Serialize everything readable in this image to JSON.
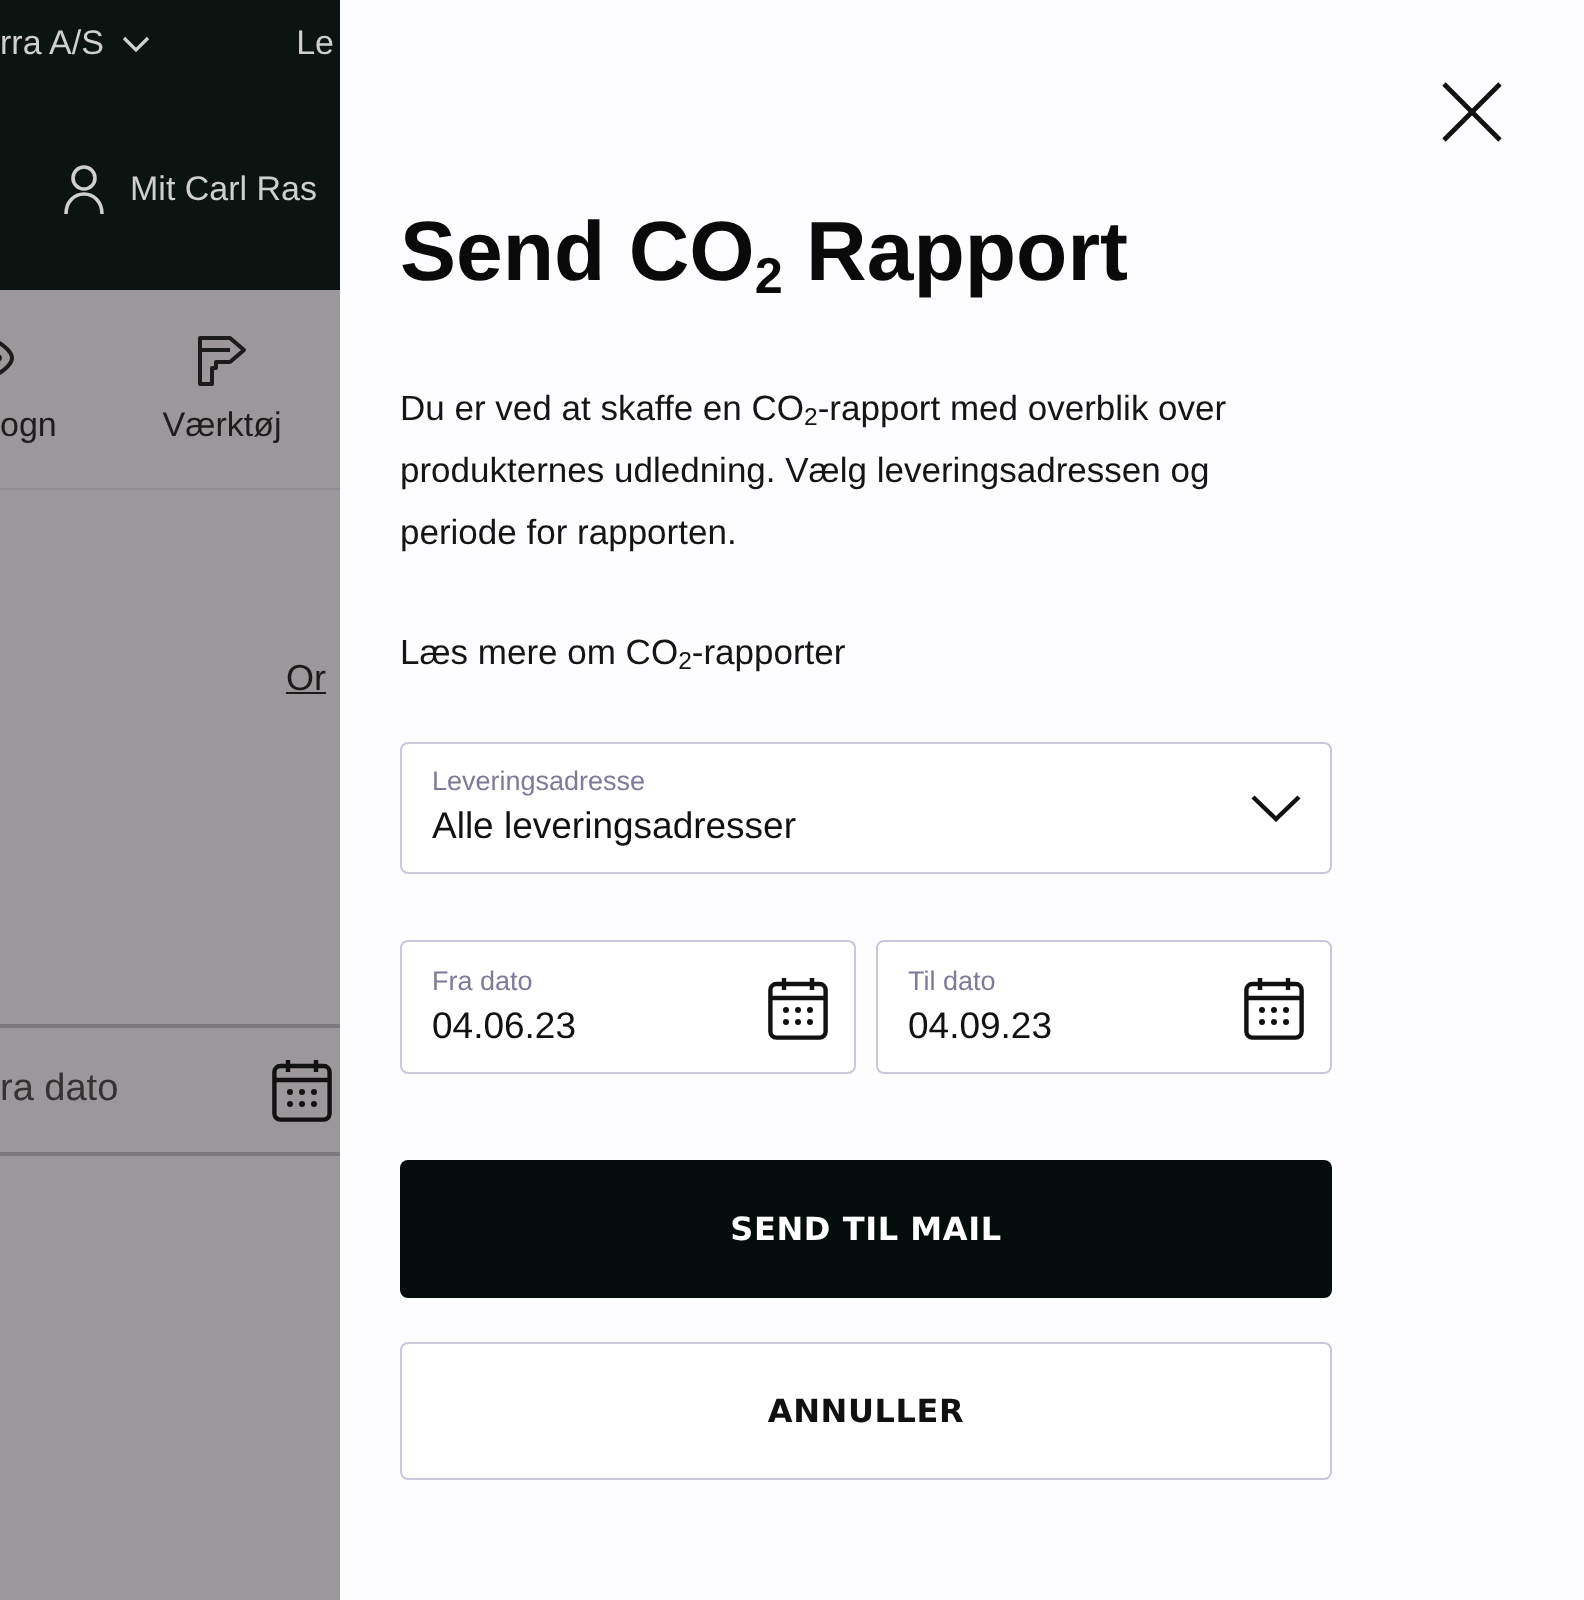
{
  "background_page": {
    "header": {
      "company_selector": "rra A/S",
      "top_link": "Le",
      "account_link": "Mit Carl Ras"
    },
    "categories": [
      {
        "label": "ogn"
      },
      {
        "label": "Værktøj"
      }
    ],
    "link": "Or",
    "date_field": {
      "placeholder": "ra dato"
    }
  },
  "dialog": {
    "title": "Send CO$_{2}$ Rapport",
    "description": "Du er ved at skaffe en CO$_{2}$-rapport med overblik over produkternes udledning. Vælg leveringsadressen og periode for rapporten.",
    "info_link": "Læs mere om CO$_{2}$-rapporter",
    "address_select": {
      "label": "Leveringsadresse",
      "value": "Alle leveringsadresser"
    },
    "date_fields": [
      {
        "label": "Fra dato",
        "value": "04.06.23"
      },
      {
        "label": "Til dato",
        "value": "04.09.23"
      }
    ],
    "buttons": [
      {
        "kind": "primary",
        "label": "SEND TIL MAIL"
      },
      {
        "kind": "secondary",
        "label": "ANNULLER"
      }
    ]
  }
}
